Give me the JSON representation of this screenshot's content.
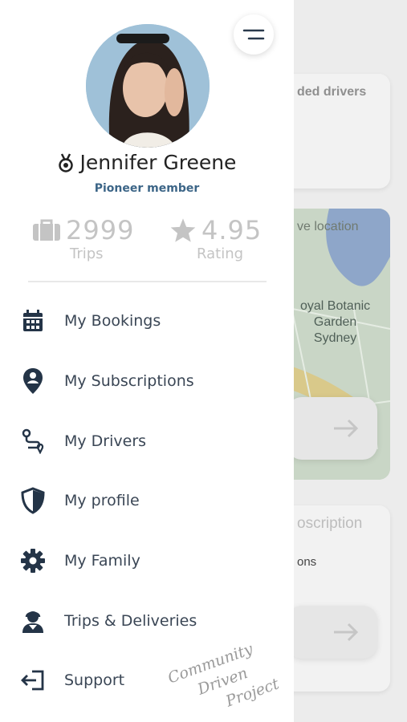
{
  "background": {
    "card1_title": "ded drivers",
    "map_title": "ve location",
    "map_place_line1": "oyal Botanic",
    "map_place_line2": "Garden",
    "map_place_line3": "Sydney",
    "card2_title": "oscription",
    "card2_sub": "ons"
  },
  "profile": {
    "name": "Jennifer Greene",
    "member_level": "Pioneer member",
    "trips_count": "2999",
    "trips_label": "Trips",
    "rating_value": "4.95",
    "rating_label": "Rating"
  },
  "menu": {
    "items": [
      {
        "label": "My Bookings",
        "icon": "calendar-icon"
      },
      {
        "label": "My Subscriptions",
        "icon": "location-pin-icon"
      },
      {
        "label": "My Drivers",
        "icon": "route-icon"
      },
      {
        "label": "My profile",
        "icon": "shield-icon"
      },
      {
        "label": "My Family",
        "icon": "gear-icon"
      },
      {
        "label": "Trips & Deliveries",
        "icon": "support-agent-icon"
      },
      {
        "label": "Support",
        "icon": "logout-icon"
      }
    ]
  },
  "watermark": {
    "line1": "Community",
    "line2": "Driven",
    "line3": "Project"
  },
  "colors": {
    "accent": "#3c6587",
    "icon": "#243447",
    "muted": "#c4c4c4"
  }
}
